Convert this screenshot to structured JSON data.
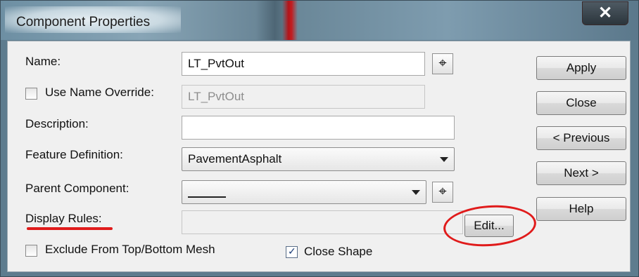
{
  "window": {
    "title": "Component Properties",
    "close_symbol": "✕"
  },
  "form": {
    "name_label": "Name:",
    "name_value": "LT_PvtOut",
    "override_label": "Use Name Override:",
    "override_value": "LT_PvtOut",
    "override_checked": false,
    "description_label": "Description:",
    "description_value": "",
    "feature_label": "Feature Definition:",
    "feature_value": "PavementAsphalt",
    "parent_label": "Parent Component:",
    "parent_value": "",
    "display_rules_label": "Display Rules:",
    "display_rules_value": "",
    "edit_label": "Edit...",
    "exclude_label": "Exclude From Top/Bottom Mesh",
    "exclude_checked": false,
    "close_shape_label": "Close Shape",
    "close_shape_checked": true,
    "pick_glyph": "⌖"
  },
  "buttons": {
    "apply": "Apply",
    "close": "Close",
    "previous": "< Previous",
    "next": "Next >",
    "help": "Help"
  },
  "annotations": {
    "highlight_color": "#e01b1b"
  }
}
